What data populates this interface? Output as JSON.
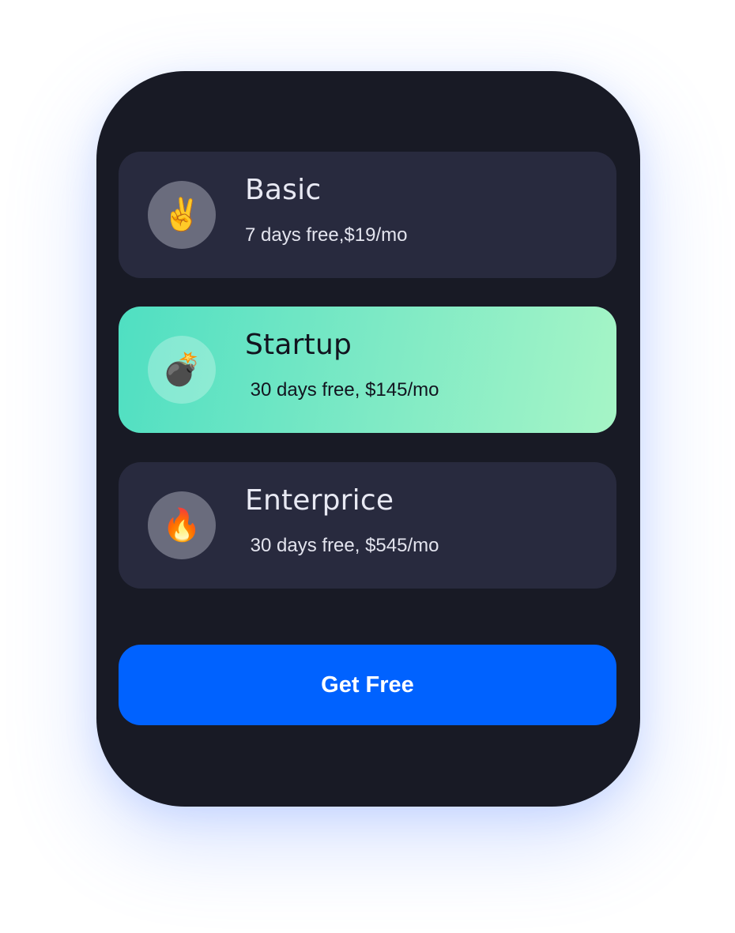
{
  "plans": [
    {
      "title": "Basic",
      "subtitle": "7 days free,$19/mo",
      "icon": "victory-hand-icon",
      "emoji": "✌️",
      "selected": false
    },
    {
      "title": "Startup",
      "subtitle": " 30 days free, $145/mo",
      "icon": "bomb-icon",
      "emoji": "💣",
      "selected": true
    },
    {
      "title": "Enterprice",
      "subtitle": " 30 days free, $545/mo",
      "icon": "fire-icon",
      "emoji": "🔥",
      "selected": false
    }
  ],
  "cta": {
    "label": "Get Free"
  },
  "colors": {
    "card_background": "#181a25",
    "plan_background": "#282a3e",
    "selected_gradient_start": "#4fdfc2",
    "selected_gradient_end": "#a6f5c6",
    "button": "#0062ff",
    "button_text": "#ffffff"
  }
}
